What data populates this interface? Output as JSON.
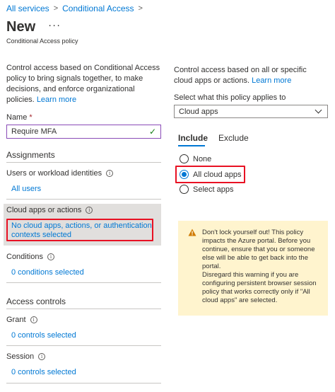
{
  "breadcrumb": {
    "items": [
      "All services",
      "Conditional Access"
    ]
  },
  "header": {
    "title": "New",
    "more_label": "···",
    "subtitle": "Conditional Access policy"
  },
  "left": {
    "description": "Control access based on Conditional Access policy to bring signals together, to make decisions, and enforce organizational policies.",
    "learn_more": "Learn more",
    "name_label": "Name",
    "name_required": "*",
    "name_value": "Require MFA",
    "assignments_title": "Assignments",
    "users_label": "Users or workload identities",
    "users_value": "All users",
    "cloud_label": "Cloud apps or actions",
    "cloud_value": "No cloud apps, actions, or authentication contexts selected",
    "conditions_label": "Conditions",
    "conditions_value": "0 conditions selected",
    "access_controls_title": "Access controls",
    "grant_label": "Grant",
    "grant_value": "0 controls selected",
    "session_label": "Session",
    "session_value": "0 controls selected"
  },
  "right": {
    "description": "Control access based on all or specific cloud apps or actions.",
    "learn_more": "Learn more",
    "select_label": "Select what this policy applies to",
    "select_value": "Cloud apps",
    "tabs": [
      "Include",
      "Exclude"
    ],
    "radio_options": [
      "None",
      "All cloud apps",
      "Select apps"
    ],
    "selected_option": "All cloud apps",
    "warning_line1": "Don't lock yourself out! This policy impacts the Azure portal. Before you continue, ensure that you or someone else will be able to get back into the portal.",
    "warning_line2": "Disregard this warning if you are configuring persistent browser session policy that works correctly only if \"All cloud apps\" are selected."
  },
  "colors": {
    "accent": "#0078d4",
    "highlight_border": "#e81123",
    "warning_bg": "#fff4ce",
    "input_border": "#8a4bb7"
  }
}
